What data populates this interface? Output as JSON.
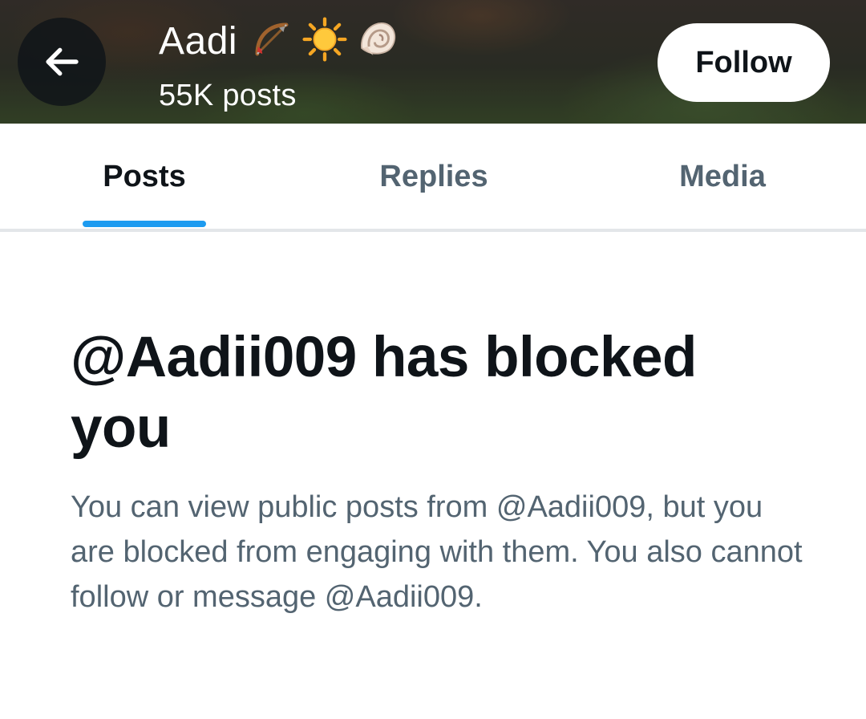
{
  "header": {
    "back_icon": "arrow-left-icon",
    "name": "Aadi",
    "emojis": [
      "🏹",
      "☀️",
      "🐚"
    ],
    "posts_count": "55K posts",
    "follow_label": "Follow"
  },
  "tabs": [
    {
      "label": "Posts",
      "active": true
    },
    {
      "label": "Replies",
      "active": false
    },
    {
      "label": "Media",
      "active": false
    }
  ],
  "colors": {
    "accent": "#1d9bf0",
    "text_primary": "#0f1419",
    "text_secondary": "#536471"
  },
  "blocked": {
    "title": "@Aadii009 has blocked you",
    "description": "You can view public posts from @Aadii009, but you are blocked from engaging with them. You also cannot follow or message @Aadii009."
  }
}
